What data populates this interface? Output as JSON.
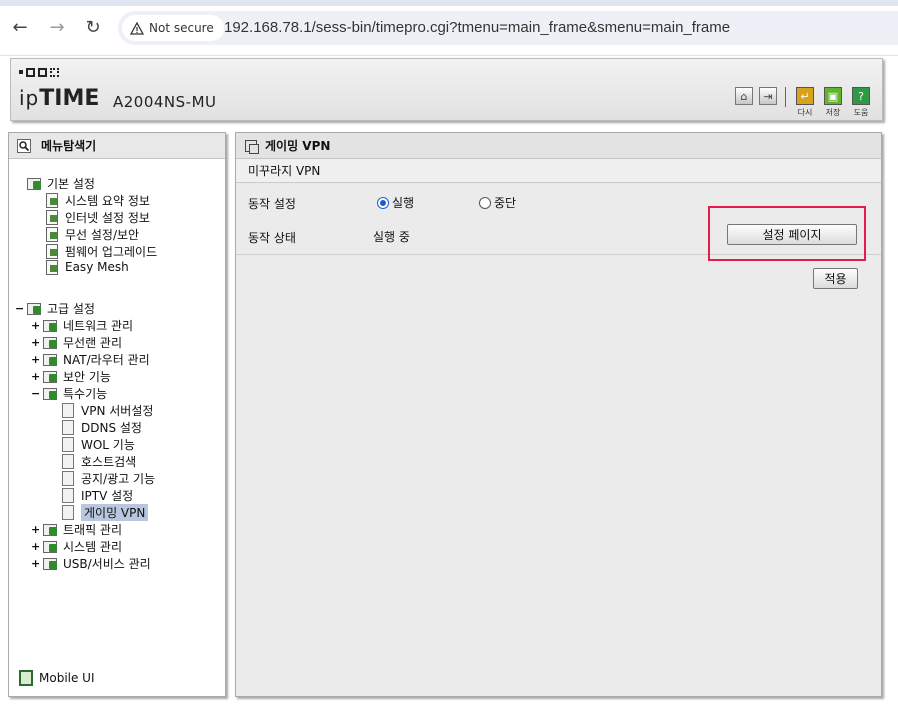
{
  "browser": {
    "back_icon": "←",
    "forward_icon": "→",
    "reload_icon": "↻",
    "security_label": "Not secure",
    "url": "192.168.78.1/sess-bin/timepro.cgi?tmenu=main_frame&smenu=main_frame"
  },
  "header": {
    "brand_prefix": "ip",
    "brand_bold": "TIME",
    "model": "A2004NS-MU",
    "buttons": [
      {
        "label": "다시",
        "color": "#d9a21b",
        "icon": "↵"
      },
      {
        "label": "저장",
        "color": "#62b32e",
        "icon": "▣"
      },
      {
        "label": "도움",
        "color": "#2e9a46",
        "icon": "?"
      }
    ]
  },
  "sidebar": {
    "title": "메뉴탐색기",
    "basic": {
      "label": "기본 설정",
      "items": [
        "시스템 요약 정보",
        "인터넷 설정 정보",
        "무선 설정/보안",
        "펌웨어 업그레이드",
        "Easy Mesh"
      ]
    },
    "advanced": {
      "label": "고급 설정",
      "collapse_symbol": "−",
      "expand_symbol": "+",
      "groups": [
        "네트워크 관리",
        "무선랜 관리",
        "NAT/라우터 관리",
        "보안 기능"
      ],
      "special": {
        "label": "특수기능",
        "items": [
          "VPN 서버설정",
          "DDNS 설정",
          "WOL 기능",
          "호스트검색",
          "공지/광고 기능",
          "IPTV 설정",
          "게이밍 VPN"
        ],
        "selected": "게이밍 VPN"
      },
      "groups_after": [
        "트래픽 관리",
        "시스템 관리",
        "USB/서비스 관리"
      ]
    },
    "mobile_label": "Mobile UI"
  },
  "main": {
    "title": "게이밍 VPN",
    "subtitle": "미꾸라지 VPN",
    "operation_label": "동작 설정",
    "radio_run": "실행",
    "radio_stop": "중단",
    "radio_selected": "run",
    "status_label": "동작 상태",
    "status_value": "실행 중",
    "settings_button": "설정 페이지",
    "apply_button": "적용"
  },
  "colors": {
    "highlight": "#e8194f",
    "selected_item": "#b8c7de"
  }
}
